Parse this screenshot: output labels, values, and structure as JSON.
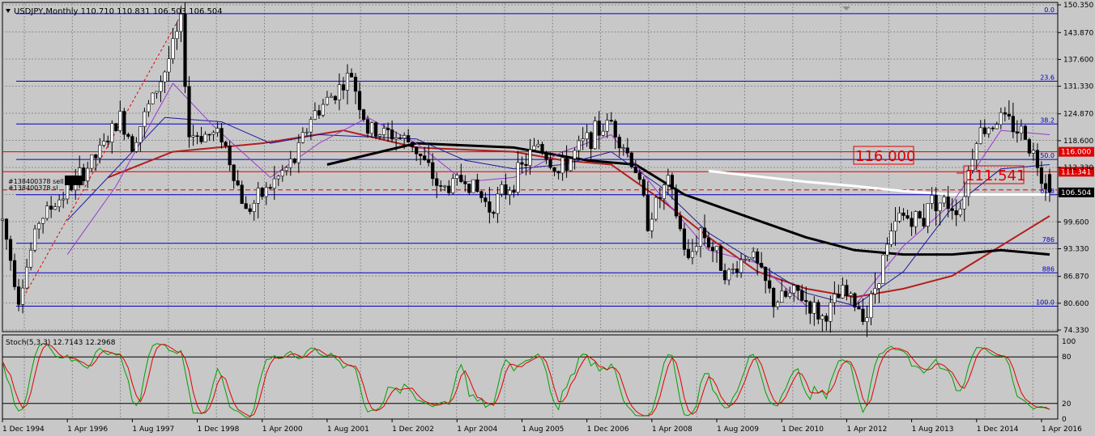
{
  "header": {
    "symbol_line": "USDJPY,Monthly  110.710 110.831 106.503 106.504",
    "menu_arrow": "triangle-down-icon"
  },
  "orders": [
    "#138400378 sell",
    "#138400378 sl"
  ],
  "stoch_header": "Stoch(5,3,3) 12.7143 12.2968",
  "colors": {
    "background": "#c8c8c8",
    "grid": "#8c8c8c",
    "candle": "#000000",
    "fib": "#0000c8",
    "hline": "#e00000",
    "ma_red": "#b41e1e",
    "ma_black": "#000000",
    "ma_blue": "#1a1a9a",
    "ma_purple": "#9a3ad0",
    "ma_white": "#ffffff",
    "stoch_main": "#00a000",
    "stoch_signal": "#e00000"
  },
  "chart_data": [
    {
      "type": "candlestick",
      "title": "USDJPY,Monthly",
      "ohlc_current": {
        "open": 110.71,
        "high": 110.831,
        "low": 106.503,
        "close": 106.504
      },
      "ylim": [
        74.33,
        150.35
      ],
      "y_ticks": [
        "150.350",
        "143.870",
        "137.600",
        "131.330",
        "124.870",
        "118.600",
        "112.330",
        "106.060",
        "99.600",
        "93.330",
        "86.870",
        "80.600",
        "74.330"
      ],
      "x_ticks": [
        "1 Dec 1994",
        "1 Apr 1996",
        "1 Aug 1997",
        "1 Dec 1998",
        "1 Apr 2000",
        "1 Aug 2001",
        "1 Dec 2002",
        "1 Apr 2004",
        "1 Aug 2005",
        "1 Dec 2006",
        "1 Apr 2008",
        "1 Aug 2009",
        "1 Dec 2010",
        "1 Apr 2012",
        "1 Aug 2013",
        "1 Dec 2014",
        "1 Apr 2016"
      ],
      "xlim": [
        "1994-12",
        "2016-08"
      ],
      "price_path": [
        [
          "1994-12",
          100.0
        ],
        [
          "1995-04",
          82.0
        ],
        [
          "1995-09",
          100.0
        ],
        [
          "1996-06",
          109.0
        ],
        [
          "1996-12",
          116.0
        ],
        [
          "1997-05",
          124.0
        ],
        [
          "1997-08",
          118.0
        ],
        [
          "1998-04",
          135.0
        ],
        [
          "1998-08",
          146.0
        ],
        [
          "1998-10",
          120.0
        ],
        [
          "1999-06",
          120.0
        ],
        [
          "1999-12",
          102.0
        ],
        [
          "2000-04",
          106.0
        ],
        [
          "2000-12",
          114.0
        ],
        [
          "2001-04",
          124.0
        ],
        [
          "2002-02",
          134.0
        ],
        [
          "2002-06",
          121.0
        ],
        [
          "2002-12",
          120.0
        ],
        [
          "2003-05",
          118.0
        ],
        [
          "2003-12",
          107.0
        ],
        [
          "2004-06",
          110.0
        ],
        [
          "2004-12",
          103.0
        ],
        [
          "2005-05",
          108.0
        ],
        [
          "2005-12",
          118.0
        ],
        [
          "2006-05",
          111.0
        ],
        [
          "2006-12",
          119.0
        ],
        [
          "2007-06",
          123.0
        ],
        [
          "2007-12",
          112.0
        ],
        [
          "2008-03",
          100.0
        ],
        [
          "2008-08",
          109.0
        ],
        [
          "2009-01",
          90.0
        ],
        [
          "2009-04",
          98.0
        ],
        [
          "2009-11",
          87.0
        ],
        [
          "2010-04",
          93.0
        ],
        [
          "2010-10",
          81.0
        ],
        [
          "2011-04",
          83.0
        ],
        [
          "2011-10",
          77.0
        ],
        [
          "2012-03",
          83.0
        ],
        [
          "2012-09",
          78.0
        ],
        [
          "2013-01",
          91.0
        ],
        [
          "2013-05",
          101.0
        ],
        [
          "2013-11",
          100.0
        ],
        [
          "2013-12",
          105.0
        ],
        [
          "2014-08",
          103.0
        ],
        [
          "2014-12",
          120.0
        ],
        [
          "2015-06",
          124.0
        ],
        [
          "2015-12",
          120.0
        ],
        [
          "2016-04",
          111.0
        ],
        [
          "2016-06",
          106.5
        ]
      ],
      "fibonacci": [
        {
          "label": "0.0",
          "value": 148.3
        },
        {
          "label": "23.6",
          "value": 132.5
        },
        {
          "label": "38.2",
          "value": 122.5
        },
        {
          "label": "50.0",
          "value": 114.2
        },
        {
          "label": "61.8",
          "value": 105.95
        },
        {
          "label": "786",
          "value": 94.6
        },
        {
          "label": "886",
          "value": 87.7
        },
        {
          "label": "100.0",
          "value": 79.9
        }
      ],
      "horizontal_lines": [
        {
          "label": "116.000",
          "value": 116.0
        },
        {
          "label": "111.341",
          "value": 111.341
        }
      ],
      "dashed_level": 107.1,
      "current_price_label": "106.504",
      "annotations": [
        {
          "text": "116.000",
          "value": 116.0
        },
        {
          "text": "111.541",
          "value": 111.541
        }
      ],
      "moving_averages": [
        {
          "color": "ma_red",
          "points": [
            [
              "1997-02",
              110
            ],
            [
              "1998-06",
              116
            ],
            [
              "2000-04",
              118
            ],
            [
              "2001-12",
              121
            ],
            [
              "2003-06",
              117
            ],
            [
              "2005-06",
              116
            ],
            [
              "2006-06",
              114
            ],
            [
              "2007-06",
              113
            ],
            [
              "2008-06",
              105
            ],
            [
              "2009-06",
              96
            ],
            [
              "2010-06",
              88
            ],
            [
              "2011-06",
              84
            ],
            [
              "2012-06",
              82
            ],
            [
              "2013-06",
              84
            ],
            [
              "2014-06",
              87
            ],
            [
              "2015-06",
              94
            ],
            [
              "2016-06",
              101
            ]
          ]
        },
        {
          "color": "ma_black",
          "points": [
            [
              "2001-08",
              113
            ],
            [
              "2003-06",
              118
            ],
            [
              "2005-06",
              117
            ],
            [
              "2006-12",
              114
            ],
            [
              "2007-12",
              113
            ],
            [
              "2008-12",
              106
            ],
            [
              "2010-06",
              100
            ],
            [
              "2011-06",
              96
            ],
            [
              "2012-06",
              93
            ],
            [
              "2013-06",
              92
            ],
            [
              "2014-06",
              92
            ],
            [
              "2015-06",
              93
            ],
            [
              "2016-06",
              92
            ]
          ]
        },
        {
          "color": "ma_white",
          "points": [
            [
              "2009-06",
              111.5
            ],
            [
              "2011-06",
              109
            ],
            [
              "2012-06",
              108
            ],
            [
              "2013-06",
              106.8
            ],
            [
              "2014-06",
              106
            ],
            [
              "2016-06",
              106
            ]
          ]
        },
        {
          "color": "ma_blue",
          "points": [
            [
              "1996-04",
              100
            ],
            [
              "1997-04",
              112
            ],
            [
              "1998-04",
              124
            ],
            [
              "1999-06",
              123
            ],
            [
              "2000-06",
              118
            ],
            [
              "2001-06",
              120
            ],
            [
              "2003-06",
              119
            ],
            [
              "2004-06",
              114
            ],
            [
              "2005-06",
              112
            ],
            [
              "2006-06",
              113
            ],
            [
              "2007-06",
              116
            ],
            [
              "2008-06",
              108
            ],
            [
              "2009-06",
              97
            ],
            [
              "2010-06",
              90
            ],
            [
              "2011-06",
              83
            ],
            [
              "2012-06",
              80
            ],
            [
              "2013-06",
              88
            ],
            [
              "2014-06",
              103
            ],
            [
              "2015-06",
              112
            ],
            [
              "2016-06",
              113
            ]
          ]
        },
        {
          "color": "ma_purple",
          "points": [
            [
              "1996-04",
              92
            ],
            [
              "1997-04",
              108
            ],
            [
              "1998-06",
              132
            ],
            [
              "1999-04",
              122
            ],
            [
              "2000-06",
              110
            ],
            [
              "2001-06",
              118
            ],
            [
              "2002-06",
              124
            ],
            [
              "2003-06",
              118
            ],
            [
              "2004-06",
              109
            ],
            [
              "2005-06",
              110
            ],
            [
              "2006-06",
              116
            ],
            [
              "2007-06",
              120
            ],
            [
              "2008-06",
              106
            ],
            [
              "2009-06",
              93
            ],
            [
              "2010-06",
              90
            ],
            [
              "2011-06",
              80
            ],
            [
              "2012-06",
              80
            ],
            [
              "2013-06",
              94
            ],
            [
              "2014-06",
              104
            ],
            [
              "2015-06",
              121
            ],
            [
              "2016-06",
              120
            ]
          ]
        }
      ],
      "trendline": {
        "from": [
          "1995-04",
          80
        ],
        "to": [
          "1998-08",
          148
        ],
        "style": "dashed"
      }
    },
    {
      "type": "line",
      "title": "Stoch(5,3,3) 12.7143 12.2968",
      "ylim": [
        0,
        100
      ],
      "y_ticks": [
        "100",
        "80",
        "20",
        "0"
      ],
      "levels": [
        80,
        20
      ],
      "series": [
        {
          "name": "%K",
          "color": "stoch_main",
          "current": 12.7143
        },
        {
          "name": "%D",
          "color": "stoch_signal",
          "current": 12.2968
        }
      ],
      "period_months": 15,
      "xlim": [
        "1994-12",
        "2016-08"
      ]
    }
  ]
}
